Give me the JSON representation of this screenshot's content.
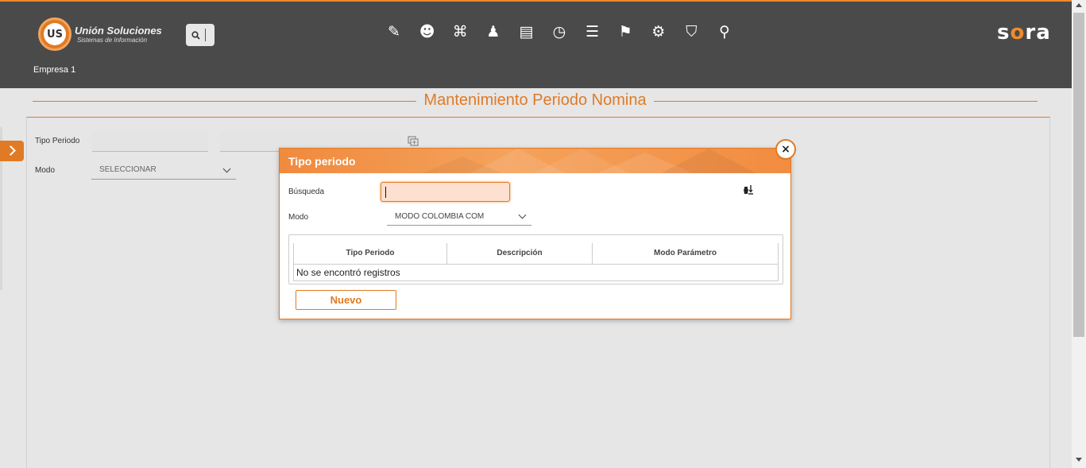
{
  "header": {
    "logo_mark": "US",
    "logo_title": "Unión Soluciones",
    "logo_subtitle": "Sistemas de Información",
    "brand": "sora",
    "company": "Empresa 1",
    "nav_icons": [
      "document-edit-icon",
      "user-profile-icon",
      "gift-icon",
      "org-chart-icon",
      "id-card-icon",
      "timer-icon",
      "report-icon",
      "presentation-icon",
      "settings-gears-icon",
      "briefcase-shield-icon",
      "user-search-icon"
    ],
    "nav_glyphs": [
      "✎",
      "☻",
      "⌘",
      "♟",
      "▤",
      "◷",
      "☰",
      "⚑",
      "⚙",
      "⛉",
      "⚲"
    ]
  },
  "page": {
    "title": "Mantenimiento Periodo Nomina",
    "form": {
      "tipo_periodo_label": "Tipo Periodo",
      "modo_label": "Modo",
      "modo_value": "SELECCIONAR"
    }
  },
  "dialog": {
    "title": "Tipo periodo",
    "close_glyph": "×",
    "busqueda_label": "Búsqueda",
    "busqueda_value": "",
    "modo_label": "Modo",
    "modo_value": "MODO COLOMBIA COM",
    "table": {
      "columns": [
        "Tipo Periodo",
        "Descripción",
        "Modo Parámetro"
      ],
      "empty_message": "No se encontró registros"
    },
    "new_button": "Nuevo"
  },
  "colors": {
    "accent": "#e07a25",
    "header_bg": "#4a4a4a",
    "page_bg": "#e6e6e6",
    "input_focus_bg": "#fde0d0"
  }
}
